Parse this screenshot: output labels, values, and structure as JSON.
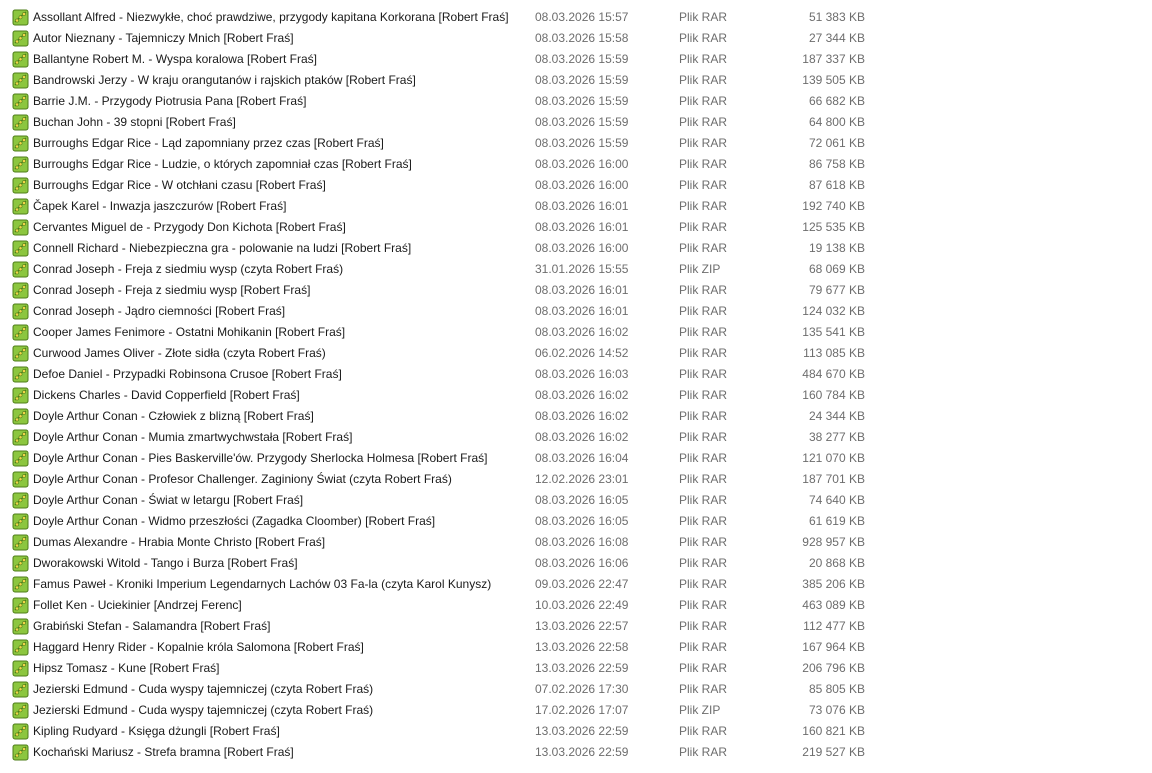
{
  "files": [
    {
      "name": "Assollant Alfred - Niezwykłe, choć prawdziwe, przygody kapitana Korkorana [Robert Fraś]",
      "modified": "08.03.2026 15:57",
      "type": "Plik RAR",
      "size": "51 383 KB",
      "icon": "archive-icon"
    },
    {
      "name": "Autor Nieznany - Tajemniczy Mnich [Robert Fraś]",
      "modified": "08.03.2026 15:58",
      "type": "Plik RAR",
      "size": "27 344 KB",
      "icon": "archive-icon"
    },
    {
      "name": "Ballantyne Robert M. - Wyspa koralowa [Robert Fraś]",
      "modified": "08.03.2026 15:59",
      "type": "Plik RAR",
      "size": "187 337 KB",
      "icon": "archive-icon"
    },
    {
      "name": "Bandrowski Jerzy - W kraju orangutanów i rajskich ptaków [Robert Fraś]",
      "modified": "08.03.2026 15:59",
      "type": "Plik RAR",
      "size": "139 505 KB",
      "icon": "archive-icon"
    },
    {
      "name": "Barrie J.M. - Przygody Piotrusia Pana [Robert Fraś]",
      "modified": "08.03.2026 15:59",
      "type": "Plik RAR",
      "size": "66 682 KB",
      "icon": "archive-icon"
    },
    {
      "name": "Buchan John - 39 stopni [Robert Fraś]",
      "modified": "08.03.2026 15:59",
      "type": "Plik RAR",
      "size": "64 800 KB",
      "icon": "archive-icon"
    },
    {
      "name": "Burroughs Edgar Rice - Ląd zapomniany przez czas [Robert Fraś]",
      "modified": "08.03.2026 15:59",
      "type": "Plik RAR",
      "size": "72 061 KB",
      "icon": "archive-icon"
    },
    {
      "name": "Burroughs Edgar Rice - Ludzie, o których zapomniał czas [Robert Fraś]",
      "modified": "08.03.2026 16:00",
      "type": "Plik RAR",
      "size": "86 758 KB",
      "icon": "archive-icon"
    },
    {
      "name": "Burroughs Edgar Rice - W otchłani czasu [Robert Fraś]",
      "modified": "08.03.2026 16:00",
      "type": "Plik RAR",
      "size": "87 618 KB",
      "icon": "archive-icon"
    },
    {
      "name": "Čapek Karel - Inwazja jaszczurów [Robert Fraś]",
      "modified": "08.03.2026 16:01",
      "type": "Plik RAR",
      "size": "192 740 KB",
      "icon": "archive-icon"
    },
    {
      "name": "Cervantes Miguel de - Przygody Don Kichota [Robert Fraś]",
      "modified": "08.03.2026 16:01",
      "type": "Plik RAR",
      "size": "125 535 KB",
      "icon": "archive-icon"
    },
    {
      "name": "Connell Richard - Niebezpieczna gra - polowanie na ludzi [Robert Fraś]",
      "modified": "08.03.2026 16:00",
      "type": "Plik RAR",
      "size": "19 138 KB",
      "icon": "archive-icon"
    },
    {
      "name": "Conrad Joseph - Freja z siedmiu wysp (czyta Robert Fraś)",
      "modified": "31.01.2026 15:55",
      "type": "Plik ZIP",
      "size": "68 069 KB",
      "icon": "archive-icon"
    },
    {
      "name": "Conrad Joseph - Freja z siedmiu wysp [Robert Fraś]",
      "modified": "08.03.2026 16:01",
      "type": "Plik RAR",
      "size": "79 677 KB",
      "icon": "archive-icon"
    },
    {
      "name": "Conrad Joseph - Jądro ciemności [Robert Fraś]",
      "modified": "08.03.2026 16:01",
      "type": "Plik RAR",
      "size": "124 032 KB",
      "icon": "archive-icon"
    },
    {
      "name": "Cooper James Fenimore - Ostatni Mohikanin [Robert Fraś]",
      "modified": "08.03.2026 16:02",
      "type": "Plik RAR",
      "size": "135 541 KB",
      "icon": "archive-icon"
    },
    {
      "name": "Curwood James Oliver - Złote sidła (czyta Robert Fraś)",
      "modified": "06.02.2026 14:52",
      "type": "Plik RAR",
      "size": "113 085 KB",
      "icon": "archive-icon"
    },
    {
      "name": "Defoe Daniel - Przypadki Robinsona Crusoe [Robert Fraś]",
      "modified": "08.03.2026 16:03",
      "type": "Plik RAR",
      "size": "484 670 KB",
      "icon": "archive-icon"
    },
    {
      "name": "Dickens Charles - David Copperfield [Robert Fraś]",
      "modified": "08.03.2026 16:02",
      "type": "Plik RAR",
      "size": "160 784 KB",
      "icon": "archive-icon"
    },
    {
      "name": "Doyle Arthur Conan - Człowiek z blizną [Robert Fraś]",
      "modified": "08.03.2026 16:02",
      "type": "Plik RAR",
      "size": "24 344 KB",
      "icon": "archive-icon"
    },
    {
      "name": "Doyle Arthur Conan - Mumia zmartwychwstała [Robert Fraś]",
      "modified": "08.03.2026 16:02",
      "type": "Plik RAR",
      "size": "38 277 KB",
      "icon": "archive-icon"
    },
    {
      "name": "Doyle Arthur Conan - Pies Baskerville'ów. Przygody Sherlocka Holmesa [Robert Fraś]",
      "modified": "08.03.2026 16:04",
      "type": "Plik RAR",
      "size": "121 070 KB",
      "icon": "archive-icon"
    },
    {
      "name": "Doyle Arthur Conan - Profesor Challenger. Zaginiony Świat (czyta Robert Fraś)",
      "modified": "12.02.2026 23:01",
      "type": "Plik RAR",
      "size": "187 701 KB",
      "icon": "archive-icon"
    },
    {
      "name": "Doyle Arthur Conan - Świat w letargu [Robert Fraś]",
      "modified": "08.03.2026 16:05",
      "type": "Plik RAR",
      "size": "74 640 KB",
      "icon": "archive-icon"
    },
    {
      "name": "Doyle Arthur Conan - Widmo przeszłości (Zagadka Cloomber) [Robert Fraś]",
      "modified": "08.03.2026 16:05",
      "type": "Plik RAR",
      "size": "61 619 KB",
      "icon": "archive-icon"
    },
    {
      "name": "Dumas Alexandre - Hrabia Monte Christo [Robert Fraś]",
      "modified": "08.03.2026 16:08",
      "type": "Plik RAR",
      "size": "928 957 KB",
      "icon": "archive-icon"
    },
    {
      "name": "Dworakowski Witold - Tango i Burza [Robert Fraś]",
      "modified": "08.03.2026 16:06",
      "type": "Plik RAR",
      "size": "20 868 KB",
      "icon": "archive-icon"
    },
    {
      "name": "Famus Paweł - Kroniki Imperium Legendarnych Lachów 03 Fa-la (czyta Karol Kunysz)",
      "modified": "09.03.2026 22:47",
      "type": "Plik RAR",
      "size": "385 206 KB",
      "icon": "archive-icon"
    },
    {
      "name": "Follet Ken - Uciekinier [Andrzej Ferenc]",
      "modified": "10.03.2026 22:49",
      "type": "Plik RAR",
      "size": "463 089 KB",
      "icon": "archive-icon"
    },
    {
      "name": "Grabiński Stefan - Salamandra [Robert Fraś]",
      "modified": "13.03.2026 22:57",
      "type": "Plik RAR",
      "size": "112 477 KB",
      "icon": "archive-icon"
    },
    {
      "name": "Haggard Henry Rider - Kopalnie króla Salomona [Robert Fraś]",
      "modified": "13.03.2026 22:58",
      "type": "Plik RAR",
      "size": "167 964 KB",
      "icon": "archive-icon"
    },
    {
      "name": "Hipsz Tomasz - Kune [Robert Fraś]",
      "modified": "13.03.2026 22:59",
      "type": "Plik RAR",
      "size": "206 796 KB",
      "icon": "archive-icon"
    },
    {
      "name": "Jezierski Edmund - Cuda wyspy tajemniczej (czyta Robert Fraś)",
      "modified": "07.02.2026 17:30",
      "type": "Plik RAR",
      "size": "85 805 KB",
      "icon": "archive-icon"
    },
    {
      "name": "Jezierski Edmund - Cuda wyspy tajemniczej (czyta Robert Fraś)",
      "modified": "17.02.2026 17:07",
      "type": "Plik ZIP",
      "size": "73 076 KB",
      "icon": "archive-icon"
    },
    {
      "name": "Kipling Rudyard - Księga dżungli [Robert Fraś]",
      "modified": "13.03.2026 22:59",
      "type": "Plik RAR",
      "size": "160 821 KB",
      "icon": "archive-icon"
    },
    {
      "name": "Kochański Mariusz - Strefa bramna [Robert Fraś]",
      "modified": "13.03.2026 22:59",
      "type": "Plik RAR",
      "size": "219 527 KB",
      "icon": "archive-icon"
    }
  ],
  "colors": {
    "icon_fill": "#8cc63f",
    "icon_border": "#4e7d1a",
    "icon_bead": "#f2d64b",
    "secondary_text": "#6d6d6d"
  }
}
